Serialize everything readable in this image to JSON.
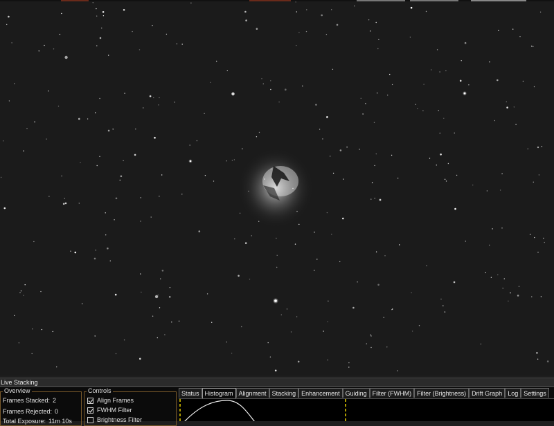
{
  "window": {
    "title": "Live Stacking"
  },
  "overview": {
    "legend": "Overview",
    "rows": [
      {
        "label": "Frames Stacked:",
        "value": "2"
      },
      {
        "label": "Frames Rejected:",
        "value": "0"
      },
      {
        "label": "Total Exposure:",
        "value": "11m 10s"
      }
    ]
  },
  "controls": {
    "legend": "Controls",
    "items": [
      {
        "label": "Align Frames",
        "checked": true
      },
      {
        "label": "FWHM Filter",
        "checked": true
      },
      {
        "label": "Brightness Filter",
        "checked": false
      }
    ]
  },
  "tabs": [
    "Status",
    "Histogram",
    "Alignment",
    "Stacking",
    "Enhancement",
    "Guiding",
    "Filter (FWHM)",
    "Filter (Brightness)",
    "Drift Graph",
    "Log",
    "Settings"
  ],
  "active_tab": "Histogram",
  "colors": {
    "accent": "#7a5a2a",
    "panel_bg": "#0b0b0b",
    "marker": "#e8d000"
  }
}
